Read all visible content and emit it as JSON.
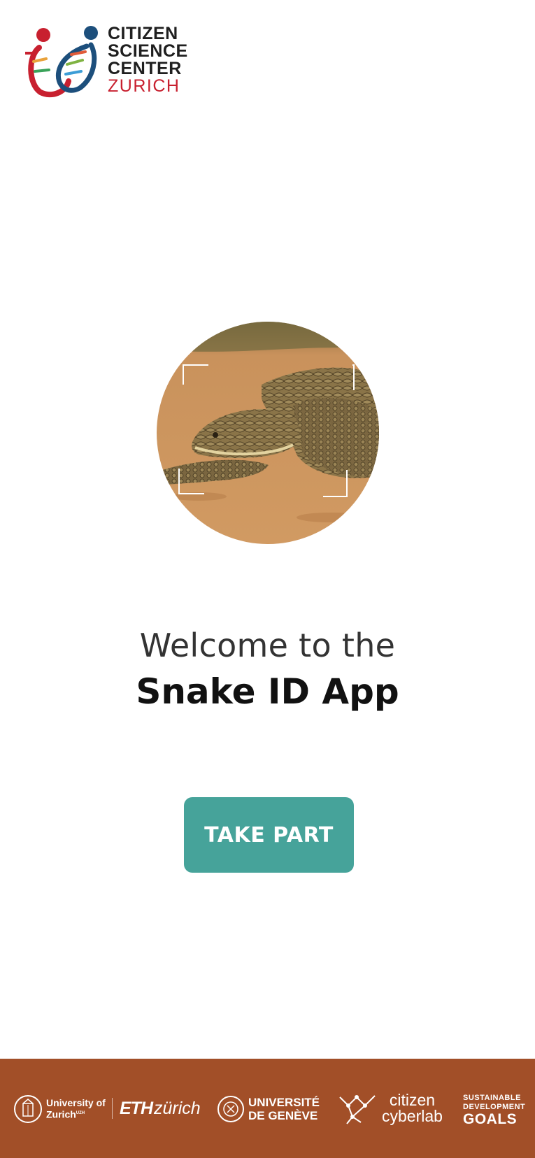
{
  "brand": {
    "line1": "CITIZEN",
    "line2": "SCIENCE",
    "line3": "CENTER",
    "line4": "ZURICH"
  },
  "welcome": {
    "line1": "Welcome to the",
    "app_name": "Snake ID App"
  },
  "cta": {
    "label": "TAKE PART"
  },
  "footer": {
    "uzh_line1": "University of",
    "uzh_line2": "Zurich",
    "uzh_sup": "UZH",
    "eth_bold": "ETH",
    "eth_rest": "zürich",
    "unige_line1": "UNIVERSITÉ",
    "unige_line2": "DE GENÈVE",
    "ccl_line1": "citizen",
    "ccl_line2": "cyberlab",
    "sdg_line1": "SUSTAINABLE",
    "sdg_line2": "DEVELOPMENT",
    "sdg_line3": "GOALS"
  },
  "colors": {
    "accent": "#46a39a",
    "footer": "#a24f28",
    "brand_red": "#c8202f",
    "brand_blue": "#1d4f7c"
  }
}
